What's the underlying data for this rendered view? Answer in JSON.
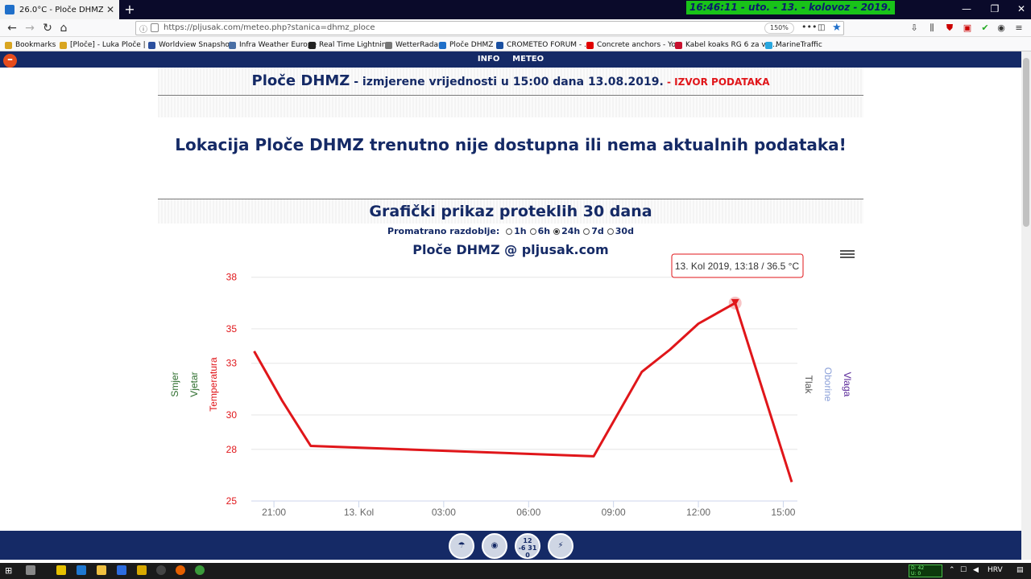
{
  "browser": {
    "tab_title": "26.0°C - Ploče DHMZ",
    "url": "https://pljusak.com/meteo.php?stanica=dhmz_ploce",
    "zoom": "150%",
    "clock_overlay": "16:46:11 -  uto. - 13. - kolovoz - 2019.",
    "bookmarks": [
      {
        "label": "Bookmarks",
        "color": "#d9a520"
      },
      {
        "label": "[Ploče] - Luka Ploče | ...",
        "color": "#d9a520"
      },
      {
        "label": "Worldview Snapshots",
        "color": "#2b4f9e"
      },
      {
        "label": "Infra Weather Europe",
        "color": "#4a6fa5"
      },
      {
        "label": "Real Time Lightning",
        "color": "#222222"
      },
      {
        "label": "WetterRadar",
        "color": "#777777"
      },
      {
        "label": "Ploče DHMZ",
        "color": "#1f6fc9"
      },
      {
        "label": "CROMETEO FORUM - ...",
        "color": "#1a4fa0"
      },
      {
        "label": "Concrete anchors - Yo...",
        "color": "#e00000"
      },
      {
        "label": "Kabel koaks RG 6 za va...",
        "color": "#c8102e"
      },
      {
        "label": "MarineTraffic",
        "color": "#2aa7df"
      }
    ]
  },
  "site": {
    "nav": [
      "INFO",
      "METEO"
    ],
    "heading_station": "Ploče DHMZ",
    "heading_measured": " - izmjerene vrijednosti u 15:00 dana 13.08.2019.",
    "heading_source": " - IZVOR PODATAKA",
    "notice": "Lokacija Ploče DHMZ trenutno nije dostupna ili nema aktualnih podataka!",
    "graph_heading": "Grafički prikaz proteklih 30 dana",
    "period_label": "Promatrano razdoblje:",
    "periods": [
      {
        "label": "1h",
        "selected": false
      },
      {
        "label": "6h",
        "selected": false
      },
      {
        "label": "24h",
        "selected": true
      },
      {
        "label": "7d",
        "selected": false
      },
      {
        "label": "30d",
        "selected": false
      }
    ],
    "footer_icons": [
      "umbrella-icon",
      "webcam-icon",
      "temperature-stats-icon",
      "storm-icon"
    ],
    "footer_stats_text": [
      "12",
      "-6 31",
      "0"
    ]
  },
  "taskbar": {
    "language": "HRV",
    "net_down": "D: 42",
    "net_up": "U: 0"
  },
  "chart_data": {
    "type": "line",
    "title": "Ploče DHMZ @ pljusak.com",
    "left_axis_labels": [
      "Smjer",
      "Vjetar",
      "Temperatura"
    ],
    "right_axis_labels": [
      "Tlak",
      "Oborine",
      "Vlaga"
    ],
    "y_ticks": [
      25,
      28,
      30,
      33,
      35,
      38
    ],
    "ylim": [
      25,
      38.5
    ],
    "x_ticks": [
      "21:00",
      "13. Kol",
      "03:00",
      "06:00",
      "09:00",
      "12:00",
      "15:00"
    ],
    "x_tick_hours": [
      0,
      3,
      6,
      9,
      12,
      15,
      18
    ],
    "xlim_hours": [
      -0.8,
      18.5
    ],
    "series": [
      {
        "name": "Temperatura",
        "color": "#e0161a",
        "x_hours": [
          -0.7,
          0.3,
          1.3,
          11.3,
          13.0,
          14.0,
          15.0,
          16.3,
          18.3
        ],
        "y": [
          33.7,
          30.8,
          28.2,
          27.6,
          32.5,
          33.8,
          35.3,
          36.5,
          26.1
        ]
      }
    ],
    "tooltip": {
      "text": "13. Kol 2019, 13:18 / 36.5 °C",
      "x_hours": 16.3,
      "y": 36.5
    }
  }
}
